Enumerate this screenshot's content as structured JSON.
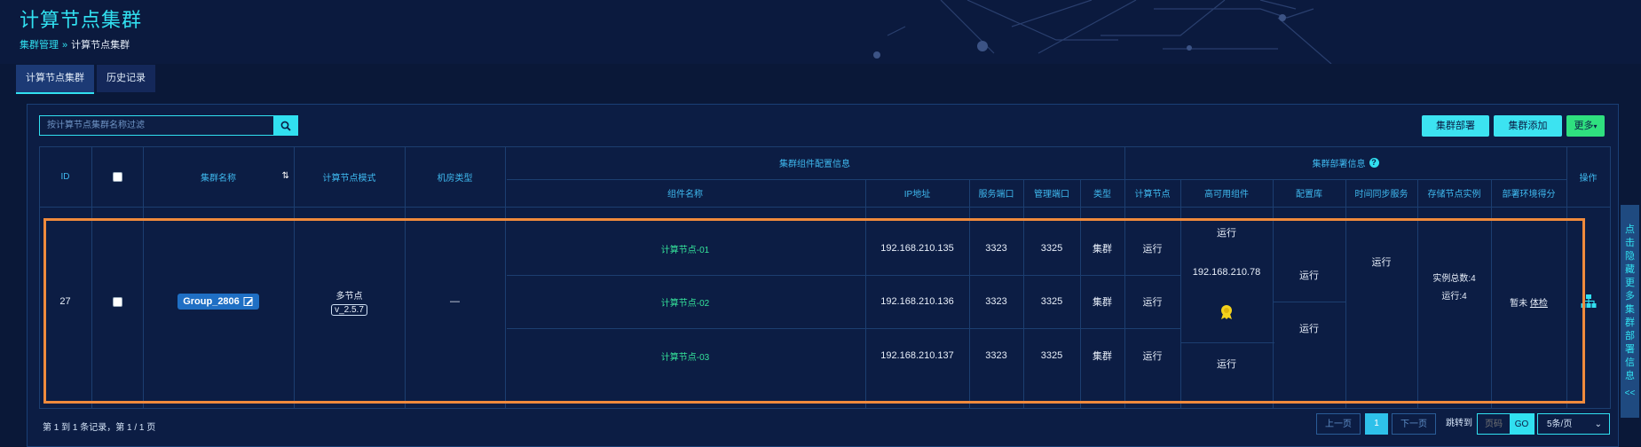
{
  "page": {
    "title": "计算节点集群",
    "breadcrumb": [
      "集群管理",
      "»",
      "计算节点集群"
    ]
  },
  "tabs": [
    {
      "label": "计算节点集群",
      "active": true
    },
    {
      "label": "历史记录",
      "active": false
    }
  ],
  "search": {
    "placeholder": "按计算节点集群名称过滤",
    "icon": "search-icon"
  },
  "toolbar": {
    "deploy": "集群部署",
    "add": "集群添加",
    "more": "更多"
  },
  "table": {
    "headers": {
      "id": "ID",
      "name": "集群名称",
      "mode": "计算节点模式",
      "room": "机房类型",
      "group_config": "集群组件配置信息",
      "group_deploy": "集群部署信息",
      "action": "操作",
      "component": "组件名称",
      "ip": "IP地址",
      "service_port": "服务端口",
      "manage_port": "管理端口",
      "type": "类型",
      "compute_node": "计算节点",
      "ha": "高可用组件",
      "config_db": "配置库",
      "time_sync": "时间同步服务",
      "storage": "存储节点实例",
      "score": "部署环境得分"
    },
    "row": {
      "id": "27",
      "name": "Group_2806",
      "mode": "多节点",
      "version": "v_2.5.7",
      "room": "—",
      "components": [
        {
          "name": "计算节点-01",
          "ip": "192.168.210.135",
          "service_port": "3323",
          "manage_port": "3325",
          "type": "集群",
          "status": "运行"
        },
        {
          "name": "计算节点-02",
          "ip": "192.168.210.136",
          "service_port": "3323",
          "manage_port": "3325",
          "type": "集群",
          "status": "运行"
        },
        {
          "name": "计算节点-03",
          "ip": "192.168.210.137",
          "service_port": "3323",
          "manage_port": "3325",
          "type": "集群",
          "status": "运行"
        }
      ],
      "ha": {
        "top_status": "运行",
        "ip": "192.168.210.78",
        "bottom_status": "运行"
      },
      "config_db": [
        "运行",
        "运行"
      ],
      "time_sync": "运行",
      "storage": {
        "total": "实例总数:4",
        "running": "运行:4"
      },
      "score": {
        "text": "暂未",
        "link": "体检"
      }
    }
  },
  "side_tab": {
    "label": "点击隐藏更多集群部署信息",
    "arrow": "<<"
  },
  "footer": {
    "info": "第 1 到 1 条记录，第 1 / 1 页",
    "prev": "上一页",
    "page": "1",
    "next": "下一页",
    "jump_label": "跳转到",
    "page_placeholder": "页码",
    "go": "GO",
    "page_size": "5条/页"
  },
  "colors": {
    "accent": "#31e0f0",
    "highlight": "#f08a3c",
    "green": "#35e29a"
  }
}
